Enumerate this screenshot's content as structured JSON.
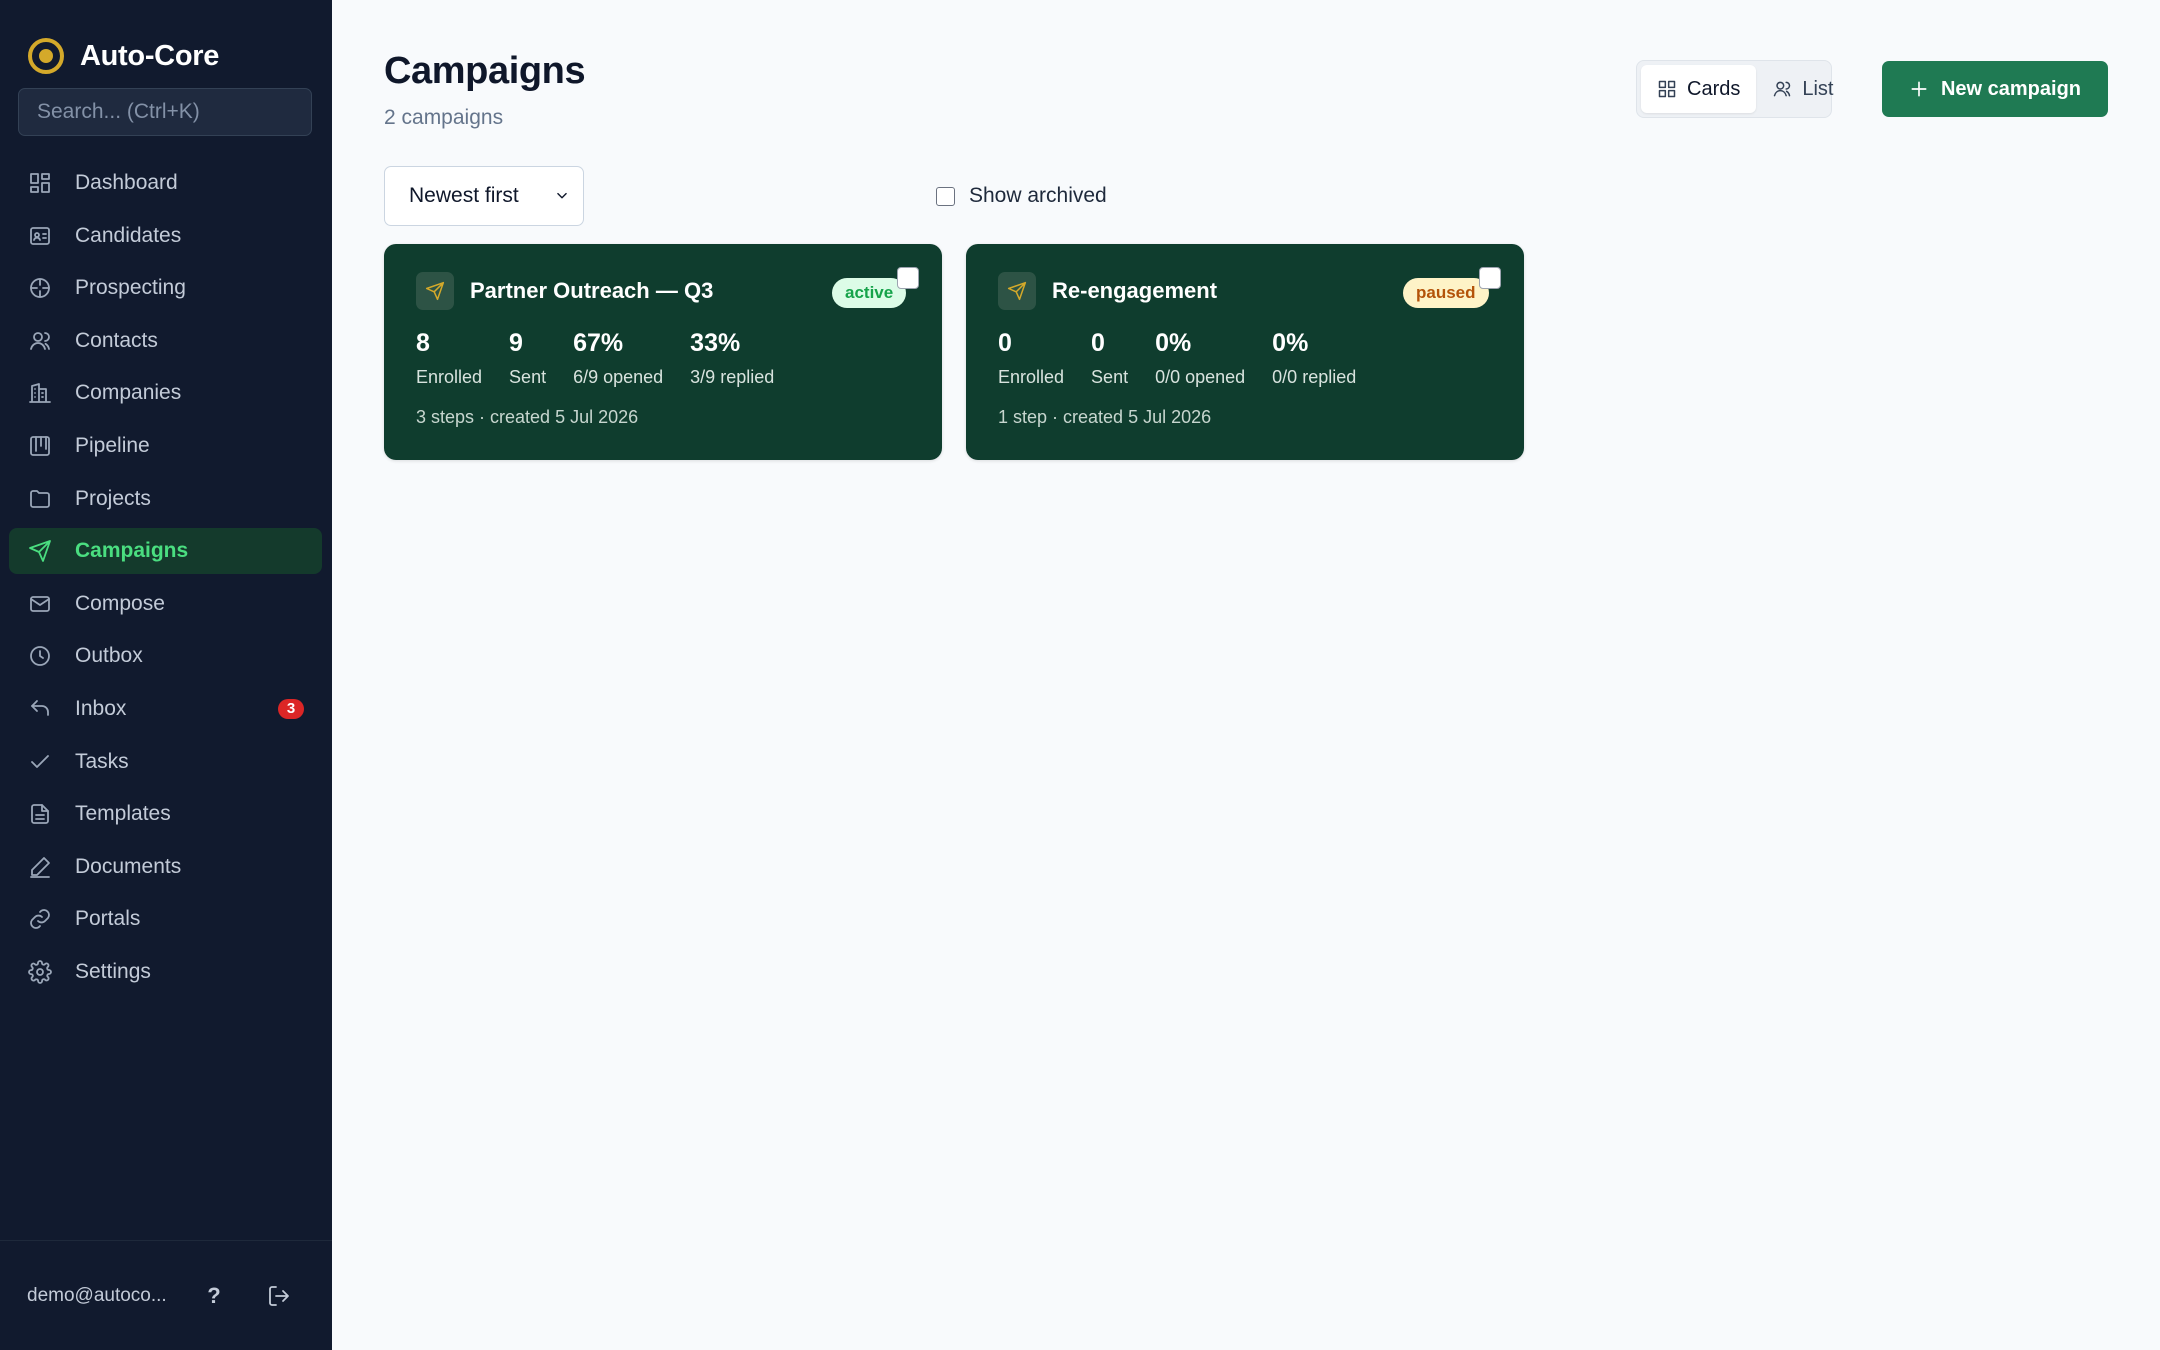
{
  "app": {
    "name": "Auto-Core"
  },
  "search": {
    "placeholder": "Search... (Ctrl+K)"
  },
  "sidebar": {
    "items": [
      {
        "label": "Dashboard",
        "icon": "dashboard-icon"
      },
      {
        "label": "Candidates",
        "icon": "id-card-icon"
      },
      {
        "label": "Prospecting",
        "icon": "crosshair-icon"
      },
      {
        "label": "Contacts",
        "icon": "user-icon"
      },
      {
        "label": "Companies",
        "icon": "building-icon"
      },
      {
        "label": "Pipeline",
        "icon": "kanban-icon"
      },
      {
        "label": "Projects",
        "icon": "folder-icon"
      },
      {
        "label": "Campaigns",
        "icon": "send-icon",
        "active": true
      },
      {
        "label": "Compose",
        "icon": "mail-icon"
      },
      {
        "label": "Outbox",
        "icon": "clock-icon"
      },
      {
        "label": "Inbox",
        "icon": "reply-icon",
        "badge": "3"
      },
      {
        "label": "Tasks",
        "icon": "check-icon"
      },
      {
        "label": "Templates",
        "icon": "file-icon"
      },
      {
        "label": "Documents",
        "icon": "pen-icon"
      },
      {
        "label": "Portals",
        "icon": "link-icon"
      },
      {
        "label": "Settings",
        "icon": "gear-icon"
      }
    ],
    "footer": {
      "email": "demo@autoco...",
      "help": "?"
    }
  },
  "header": {
    "title": "Campaigns",
    "subtitle": "2 campaigns",
    "view_toggle": {
      "cards": "Cards",
      "list": "List",
      "selected": "Cards"
    },
    "new_button": "New campaign"
  },
  "filters": {
    "sort": "Newest first",
    "show_archived": "Show archived"
  },
  "campaigns": [
    {
      "name": "Partner Outreach — Q3",
      "status": "active",
      "stats": [
        {
          "value": "8",
          "label": "Enrolled"
        },
        {
          "value": "9",
          "label": "Sent"
        },
        {
          "value": "67%",
          "label": "6/9 opened"
        },
        {
          "value": "33%",
          "label": "3/9 replied"
        }
      ],
      "meta": "3 steps · created 5 Jul 2026"
    },
    {
      "name": "Re-engagement",
      "status": "paused",
      "stats": [
        {
          "value": "0",
          "label": "Enrolled"
        },
        {
          "value": "0",
          "label": "Sent"
        },
        {
          "value": "0%",
          "label": "0/0 opened"
        },
        {
          "value": "0%",
          "label": "0/0 replied"
        }
      ],
      "meta": "1 step · created 5 Jul 2026"
    }
  ],
  "colors": {
    "sidebar_bg": "#111a2e",
    "accent": "#1f7a53",
    "card_bg": "#0f3d2e",
    "active_nav": "#4ade80",
    "brand": "#d4a92a",
    "badge": "#dc2626"
  }
}
